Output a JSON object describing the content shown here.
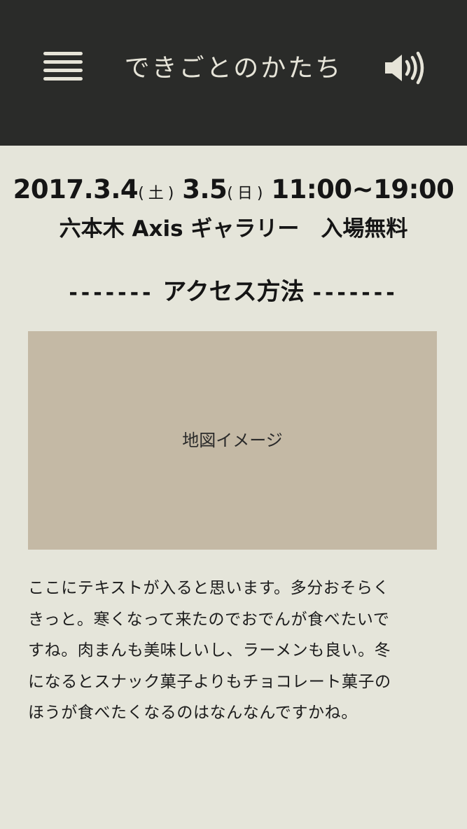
{
  "header": {
    "title": "できごとのかたち",
    "menu_icon": "hamburger-menu-icon",
    "sound_icon": "speaker-volume-icon"
  },
  "event": {
    "date1": "2017.3.4",
    "day1": "( 土 )",
    "date2": "3.5",
    "day2": "( 日 )",
    "time": "11:00~19:00",
    "venue": "六本木 Axis ギャラリー",
    "admission": "入場無料"
  },
  "access": {
    "dashes_left": "-------",
    "title": "アクセス方法",
    "dashes_right": "-------",
    "map_label": "地図イメージ"
  },
  "description": {
    "lines": [
      "ここにテキストが入ると思います。多分おそらく",
      "きっと。寒くなって来たのでおでんが食べたいで",
      "すね。肉まんも美味しいし、ラーメンも良い。冬",
      "になるとスナック菓子よりもチョコレート菓子の",
      "ほうが食べたくなるのはなんなんですかね。"
    ]
  },
  "colors": {
    "header_bg": "#2a2b29",
    "page_bg": "#e5e5da",
    "map_bg": "#c4b9a5",
    "header_text": "#e6e4d8"
  }
}
